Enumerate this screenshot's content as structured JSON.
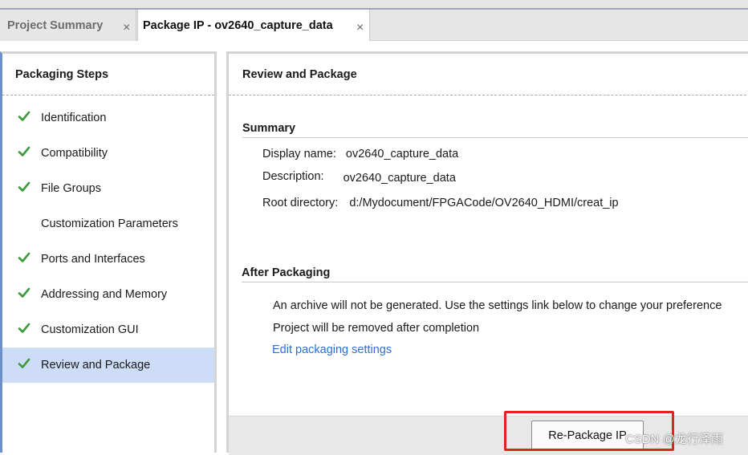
{
  "tabs": [
    {
      "label": "Project Summary",
      "active": false
    },
    {
      "label": "Package IP - ov2640_capture_data",
      "active": true
    }
  ],
  "tab_close_glyph": "×",
  "left_panel": {
    "title": "Packaging Steps",
    "steps": [
      {
        "label": "Identification",
        "done": true
      },
      {
        "label": "Compatibility",
        "done": true
      },
      {
        "label": "File Groups",
        "done": true
      },
      {
        "label": "Customization Parameters",
        "done": false
      },
      {
        "label": "Ports and Interfaces",
        "done": true
      },
      {
        "label": "Addressing and Memory",
        "done": true
      },
      {
        "label": "Customization GUI",
        "done": true
      },
      {
        "label": "Review and Package",
        "done": true,
        "selected": true
      }
    ],
    "check_icon": "checkmark-icon",
    "check_color": "#3f9a3f",
    "selected_bg": "#cddcf7"
  },
  "main": {
    "title": "Review and Package",
    "summary": {
      "heading": "Summary",
      "display_name_label": "Display name:",
      "display_name_value": "ov2640_capture_data",
      "description_label": "Description:",
      "description_value": "ov2640_capture_data",
      "root_dir_label": "Root directory:",
      "root_dir_value": "d:/Mydocument/FPGACode/OV2640_HDMI/creat_ip"
    },
    "after_packaging": {
      "heading": "After Packaging",
      "line1": "An archive will not be generated. Use the settings link below to change your preference",
      "line2": "Project will be removed after completion",
      "link": "Edit packaging settings"
    },
    "button_label": "Re-Package IP"
  },
  "watermark": "CSDN @龙行泽雨",
  "colors": {
    "link": "#2d6fd6",
    "highlight": "#e0241f",
    "accent_border": "#6d8fc9"
  }
}
